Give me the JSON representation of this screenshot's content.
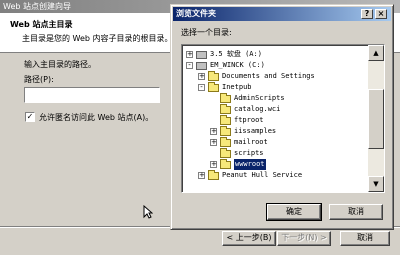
{
  "wizard": {
    "title": "Web 站点创建向导",
    "header_title": "Web 站点主目录",
    "header_desc": "主目录是您的 Web 内容子目录的根目录。",
    "prompt": "输入主目录的路径。",
    "path_label": "路径(P):",
    "path_value": "",
    "checkbox_checked": true,
    "checkbox_mark": "✓",
    "checkbox_label": "允许匿名访问此 Web 站点(A)。",
    "back_button": "< 上一步(B)",
    "next_button": "下一步(N) >",
    "cancel_button": "取消"
  },
  "dialog": {
    "title": "浏览文件夹",
    "help_button": "?",
    "close_button": "×",
    "select_label": "选择一个目录:",
    "tree": [
      {
        "label": "3.5 软盘 (A:)",
        "level": 1,
        "toggle": "+",
        "icon": "drive"
      },
      {
        "label": "EM_WINCK (C:)",
        "level": 1,
        "toggle": "-",
        "icon": "drive"
      },
      {
        "label": "Documents and Settings",
        "level": 2,
        "toggle": "+",
        "icon": "folder"
      },
      {
        "label": "Inetpub",
        "level": 2,
        "toggle": "-",
        "icon": "folder"
      },
      {
        "label": "AdminScripts",
        "level": 3,
        "toggle": "",
        "icon": "folder"
      },
      {
        "label": "catalog.wci",
        "level": 3,
        "toggle": "",
        "icon": "folder"
      },
      {
        "label": "ftproot",
        "level": 3,
        "toggle": "",
        "icon": "folder"
      },
      {
        "label": "iissamples",
        "level": 3,
        "toggle": "+",
        "icon": "folder"
      },
      {
        "label": "mailroot",
        "level": 3,
        "toggle": "+",
        "icon": "folder"
      },
      {
        "label": "scripts",
        "level": 3,
        "toggle": "",
        "icon": "folder"
      },
      {
        "label": "wwwroot",
        "level": 3,
        "toggle": "+",
        "icon": "folder",
        "selected": true
      },
      {
        "label": "Peanut Hull Service",
        "level": 2,
        "toggle": "+",
        "icon": "folder"
      }
    ],
    "scroll_up": "▲",
    "scroll_down": "▼",
    "ok_button": "确定",
    "cancel_button": "取消"
  }
}
